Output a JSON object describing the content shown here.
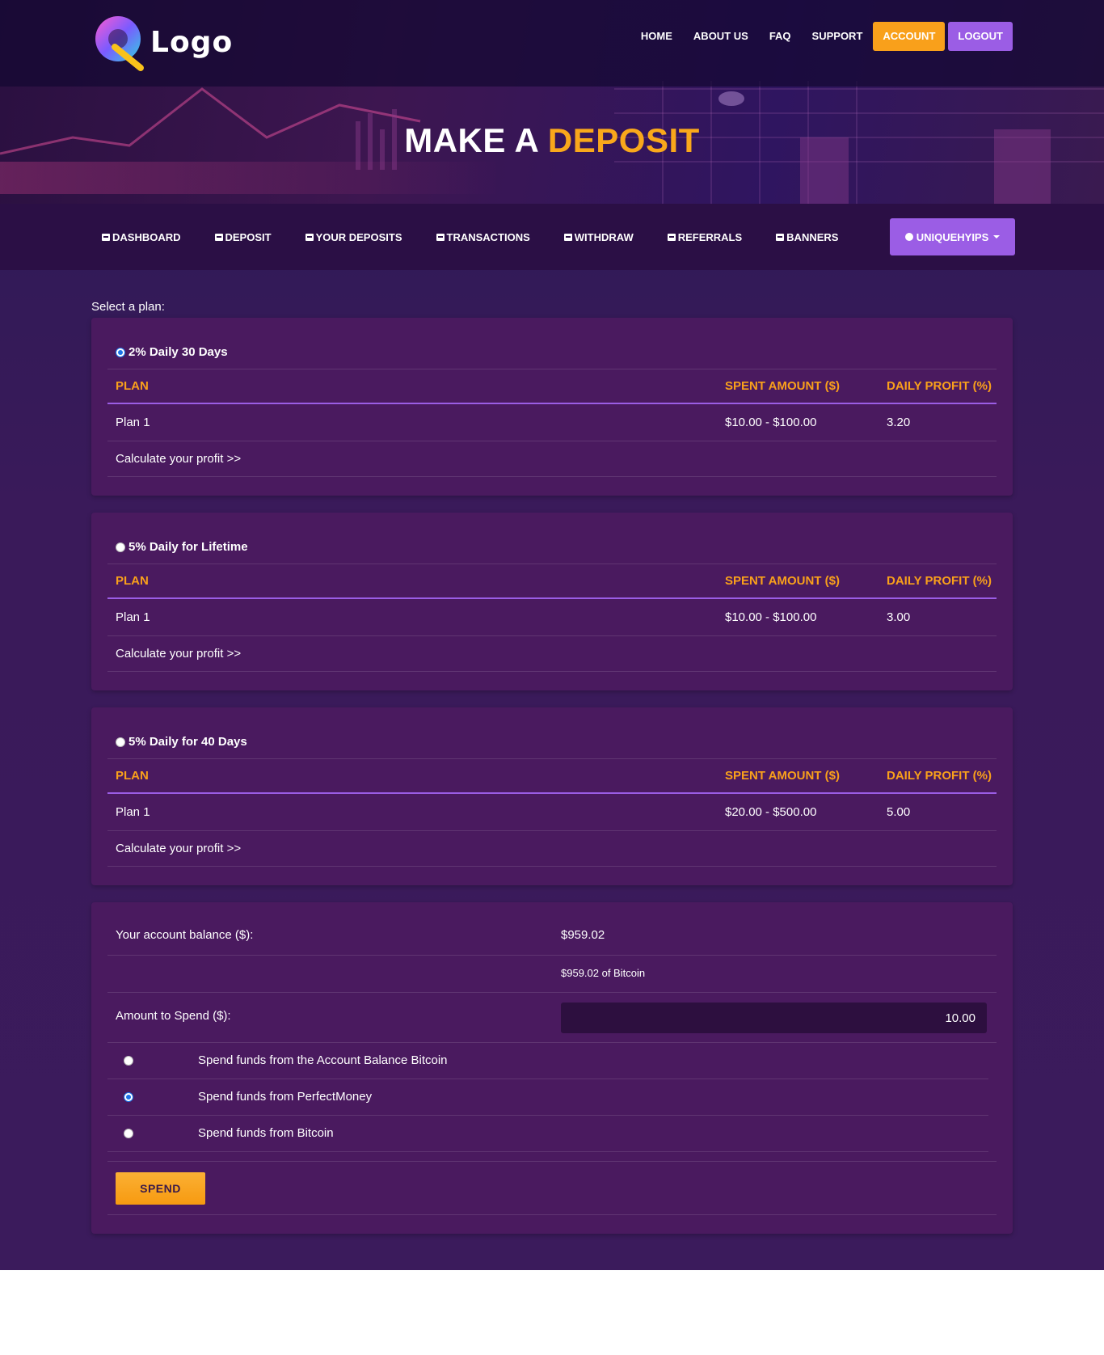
{
  "header": {
    "logo_text": "Logo",
    "nav": [
      {
        "label": "HOME"
      },
      {
        "label": "ABOUT US"
      },
      {
        "label": "FAQ"
      },
      {
        "label": "SUPPORT"
      }
    ],
    "account_label": "ACCOUNT",
    "logout_label": "LOGOUT"
  },
  "hero": {
    "title_plain": "MAKE A",
    "title_highlight": "DEPOSIT"
  },
  "subnav": {
    "items": [
      {
        "label": "DASHBOARD"
      },
      {
        "label": "DEPOSIT"
      },
      {
        "label": "YOUR DEPOSITS"
      },
      {
        "label": "TRANSACTIONS"
      },
      {
        "label": "WITHDRAW"
      },
      {
        "label": "REFERRALS"
      },
      {
        "label": "BANNERS"
      }
    ],
    "user_label": "UNIQUEHYIPS"
  },
  "deposit": {
    "select_label": "Select a plan:",
    "columns": {
      "plan": "PLAN",
      "spent": "SPENT AMOUNT ($)",
      "profit": "DAILY PROFIT (%)"
    },
    "plans": [
      {
        "title": "2% Daily 30 Days",
        "selected": true,
        "row_plan": "Plan 1",
        "row_spent": "$10.00 - $100.00",
        "row_profit": "3.20",
        "calc": "Calculate your profit >>"
      },
      {
        "title": "5% Daily for Lifetime",
        "selected": false,
        "row_plan": "Plan 1",
        "row_spent": "$10.00 - $100.00",
        "row_profit": "3.00",
        "calc": "Calculate your profit >>"
      },
      {
        "title": "5% Daily for 40 Days",
        "selected": false,
        "row_plan": "Plan 1",
        "row_spent": "$20.00 - $500.00",
        "row_profit": "5.00",
        "calc": "Calculate your profit >>"
      }
    ],
    "balance_label": "Your account balance ($):",
    "balance_value": "$959.02",
    "balance_detail": "$959.02 of Bitcoin",
    "amount_label": "Amount to Spend ($):",
    "amount_value": "10.00",
    "methods": [
      {
        "label": "Spend funds from the Account Balance Bitcoin",
        "selected": false
      },
      {
        "label": "Spend funds from PerfectMoney",
        "selected": true
      },
      {
        "label": "Spend funds from Bitcoin",
        "selected": false
      }
    ],
    "spend_label": "SPEND"
  },
  "colors": {
    "accent_orange": "#f9a01b",
    "accent_purple": "#9b5de5",
    "card_bg": "#4a1a5f"
  }
}
